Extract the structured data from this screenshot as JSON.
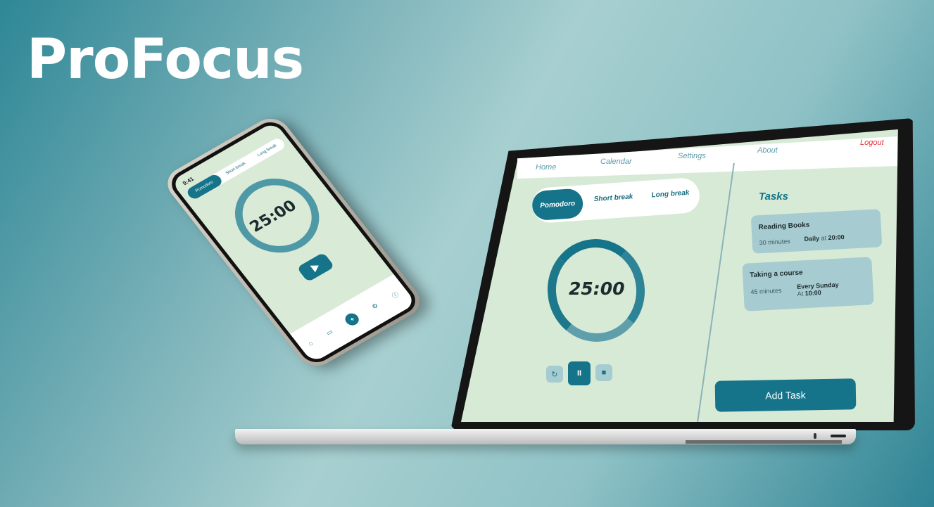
{
  "brand": {
    "title": "ProFocus"
  },
  "phone": {
    "status_time": "9:41",
    "tabs": [
      "Pomodoro",
      "Short break",
      "Long break"
    ],
    "timer": "25:00",
    "nav_plus": "+"
  },
  "laptop": {
    "nav": [
      "Home",
      "Calendar",
      "Settings",
      "About"
    ],
    "logout": "Logout",
    "tabs": [
      "Pomodoro",
      "Short break",
      "Long break"
    ],
    "timer": "25:00",
    "controls": {
      "reset": "↻",
      "pause": "II",
      "stop": "■"
    },
    "tasks_title": "Tasks",
    "tasks": [
      {
        "name": "Reading Books",
        "duration": "30 minutes",
        "schedule_prefix": "Daily",
        "schedule_mid": "at",
        "schedule_time": "20:00"
      },
      {
        "name": "Taking a course",
        "duration": "45 minutes",
        "schedule_prefix": "Every Sunday",
        "schedule_mid": "At",
        "schedule_time": "10:00"
      }
    ],
    "add_task": "Add Task"
  },
  "colors": {
    "accent": "#15748a",
    "screen_bg": "#d7ead6",
    "logout": "#e0323c"
  }
}
